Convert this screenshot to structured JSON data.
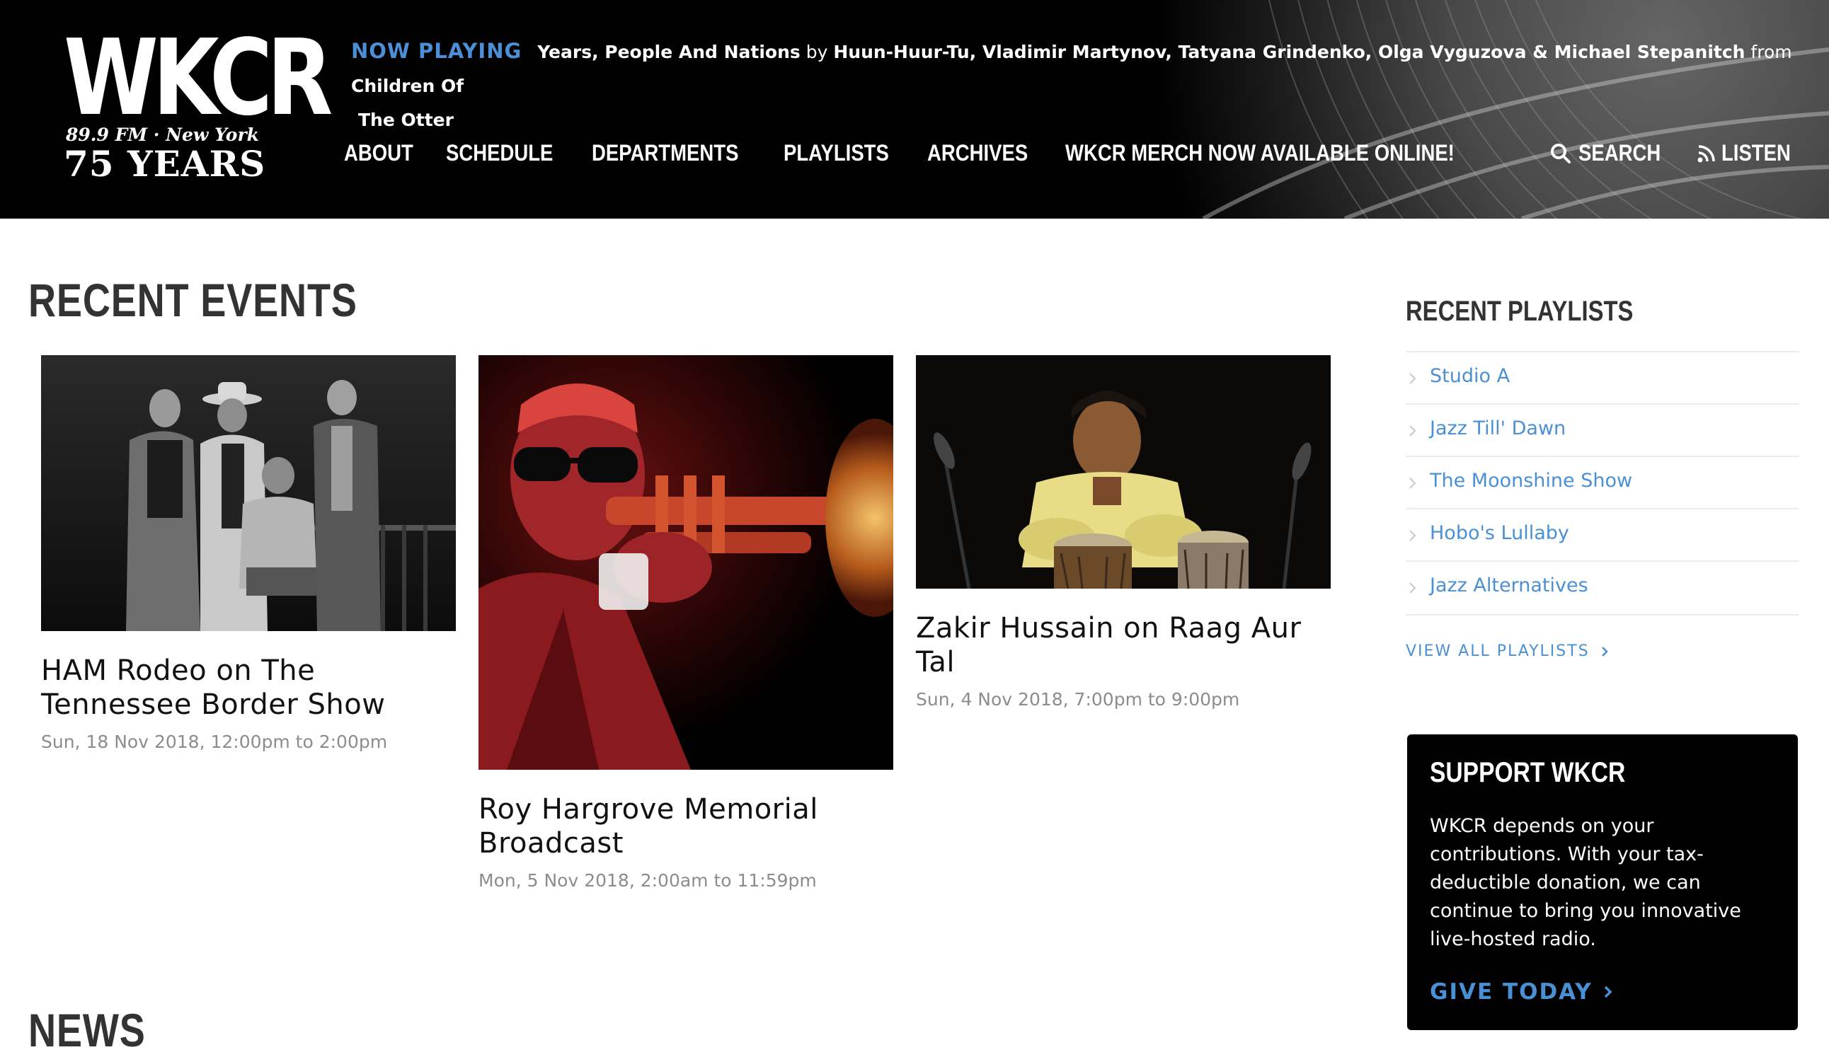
{
  "header": {
    "logo": {
      "wordmark": "WKCR",
      "frequency": "89.9 FM · New York",
      "anniversary": "75 YEARS"
    },
    "now_playing": {
      "label": "NOW PLAYING",
      "track": "Years, People And Nations",
      "by_word": "by",
      "artists": "Huun-Huur-Tu, Vladimir Martynov, Tatyana Grindenko, Olga Vyguzova & Michael Stepanitch",
      "from_word": "from",
      "album_part1": "Children Of",
      "album_part2": "The Otter"
    },
    "nav": [
      {
        "label": "ABOUT"
      },
      {
        "label": "SCHEDULE"
      },
      {
        "label": "DEPARTMENTS"
      },
      {
        "label": "PLAYLISTS"
      },
      {
        "label": "ARCHIVES"
      },
      {
        "label": "WKCR MERCH NOW AVAILABLE ONLINE!"
      }
    ],
    "search_label": "SEARCH",
    "listen_label": "LISTEN"
  },
  "recent_events": {
    "title": "RECENT EVENTS",
    "events": [
      {
        "title": "HAM Rodeo on The Tennessee Border Show",
        "date": "Sun, 18 Nov 2018, 12:00pm to 2:00pm"
      },
      {
        "title": "Roy Hargrove Memorial Broadcast",
        "date": "Mon, 5 Nov 2018, 2:00am to 11:59pm"
      },
      {
        "title": "Zakir Hussain on Raag Aur Tal",
        "date": "Sun, 4 Nov 2018, 7:00pm to 9:00pm"
      }
    ]
  },
  "news": {
    "title": "NEWS"
  },
  "sidebar": {
    "playlists_title": "RECENT PLAYLISTS",
    "playlists": [
      {
        "label": "Studio A"
      },
      {
        "label": "Jazz Till' Dawn"
      },
      {
        "label": "The Moonshine Show"
      },
      {
        "label": "Hobo's Lullaby"
      },
      {
        "label": "Jazz Alternatives"
      }
    ],
    "view_all_label": "VIEW ALL PLAYLISTS",
    "support": {
      "title": "SUPPORT WKCR",
      "text": "WKCR depends on your contributions. With your tax-deductible donation, we can continue to bring you innovative live-hosted radio.",
      "cta": "GIVE TODAY"
    }
  },
  "colors": {
    "accent": "#4a90d4",
    "header_bg": "#000000",
    "heading": "#333333",
    "date_text": "#8c8c8c"
  }
}
